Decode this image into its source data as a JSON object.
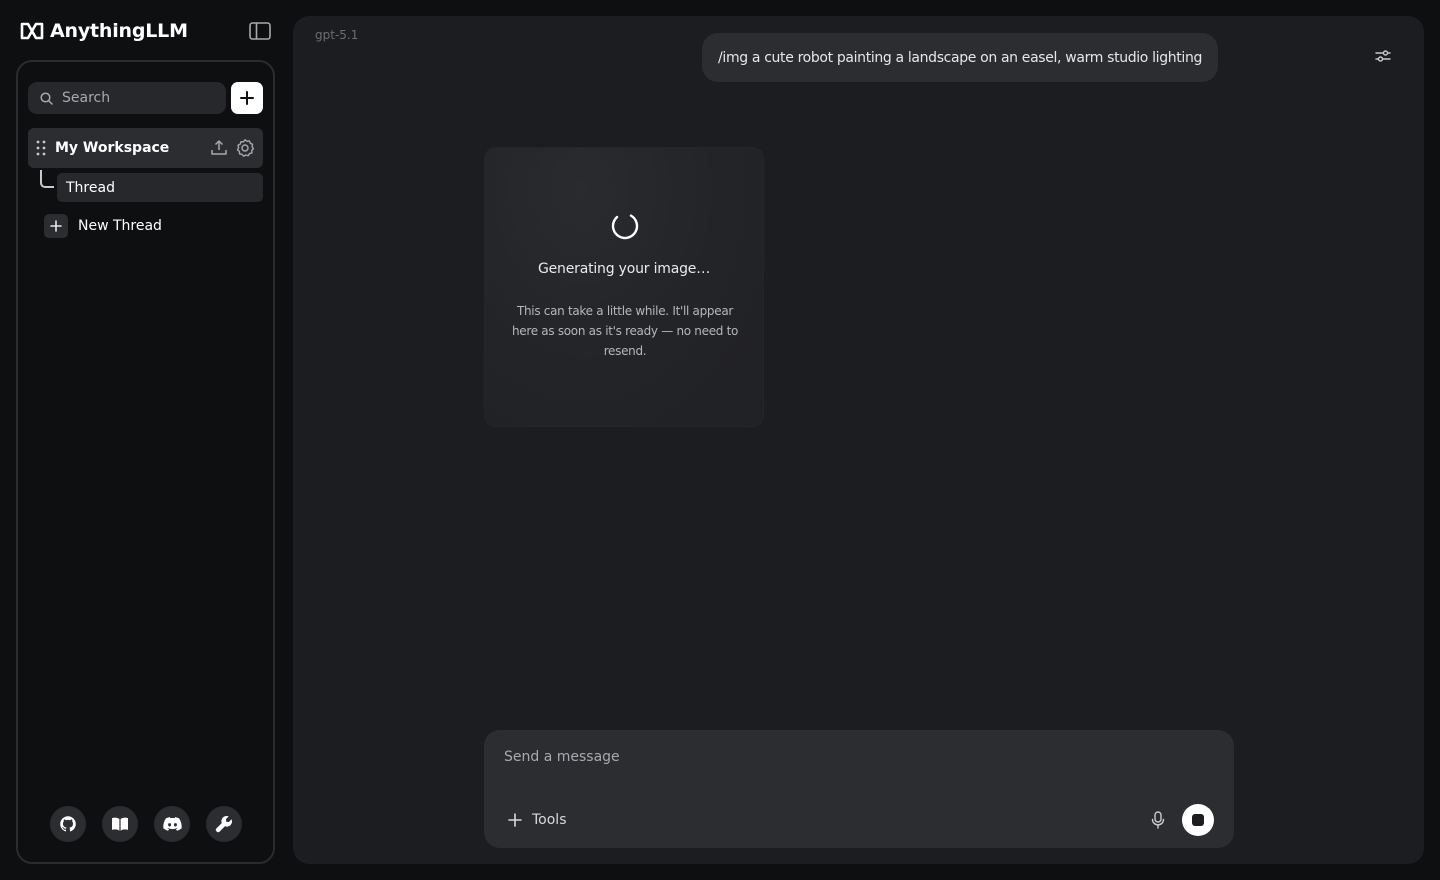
{
  "app": {
    "name": "AnythingLLM"
  },
  "sidebar": {
    "search_placeholder": "Search",
    "workspace": {
      "name": "My Workspace"
    },
    "threads": [
      {
        "label": "Thread"
      }
    ],
    "new_thread_label": "New Thread",
    "footer_icons": [
      "github-icon",
      "docs-book-icon",
      "discord-icon",
      "wrench-icon"
    ]
  },
  "chat": {
    "model": "gpt-5.1",
    "user_message": "/img a cute robot painting a landscape on an easel, warm studio lighting",
    "generating": {
      "title": "Generating your image…",
      "description": "This can take a little while. It'll appear here as soon as it's ready — no need to resend."
    }
  },
  "composer": {
    "placeholder": "Send a message",
    "tools_label": "Tools"
  },
  "colors": {
    "background": "#0e0f11",
    "panel": "#1c1d21",
    "surface": "#2b2d31",
    "accent": "#ffffff"
  }
}
